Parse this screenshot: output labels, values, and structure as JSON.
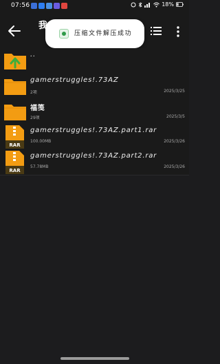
{
  "status_bar": {
    "time": "07:56",
    "battery": "18%",
    "app_icon_colors": [
      "#3b6fd8",
      "#2d7df0",
      "#4a90e2",
      "#6a5be0",
      "#e0463f"
    ]
  },
  "app_bar": {
    "title_fragment": "我",
    "back_icon": "arrow-left-icon",
    "view_icon": "list-view-icon",
    "menu_icon": "more-vertical-icon"
  },
  "toast": {
    "message": "压缩文件解压成功",
    "icon": "archive-check-icon"
  },
  "files": [
    {
      "name": "..",
      "sub": "",
      "date": "",
      "kind": "parent-folder"
    },
    {
      "name": "gamerstruggles!.73AZ",
      "sub": "2项",
      "date": "2025/3/25",
      "kind": "folder"
    },
    {
      "name": "福笺",
      "sub": "29项",
      "date": "2025/3/5",
      "kind": "folder"
    },
    {
      "name": "gamerstruggles!.73AZ.part1.rar",
      "sub": "100.00MB",
      "date": "2025/3/26",
      "kind": "rar"
    },
    {
      "name": "gamerstruggles!.73AZ.part2.rar",
      "sub": "57.78MB",
      "date": "2025/3/26",
      "kind": "rar"
    }
  ],
  "colors": {
    "folder": "#f39c12",
    "parent_arrow": "#3cae3c",
    "rar_band": "#4a3a14"
  }
}
